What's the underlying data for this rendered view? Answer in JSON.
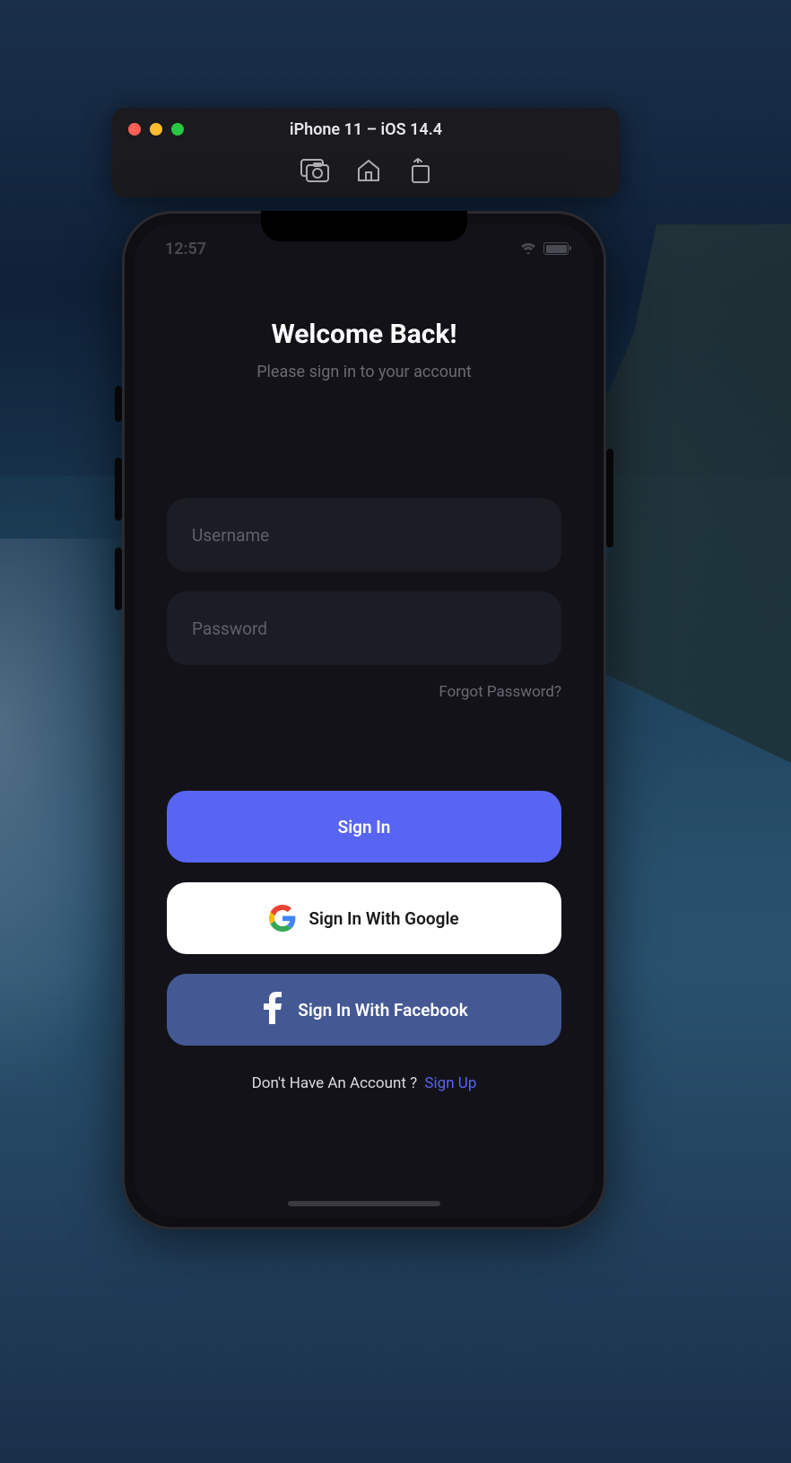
{
  "simulator": {
    "title": "iPhone 11 – iOS 14.4"
  },
  "statusBar": {
    "time": "12:57"
  },
  "login": {
    "title": "Welcome Back!",
    "subtitle": "Please sign in to your account",
    "usernamePlaceholder": "Username",
    "passwordPlaceholder": "Password",
    "forgot": "Forgot Password?",
    "signIn": "Sign In",
    "google": "Sign In With Google",
    "facebook": "Sign In With Facebook",
    "noAccount": "Don't Have An Account ?",
    "signUp": "Sign Up"
  }
}
